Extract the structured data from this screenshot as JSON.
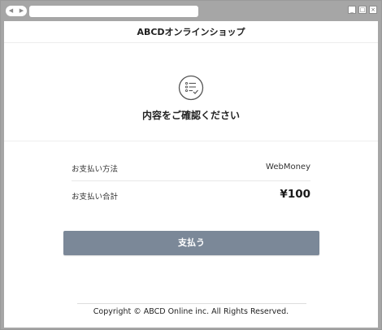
{
  "browser": {
    "nav_icons": [
      "back-icon",
      "forward-icon"
    ],
    "window_controls": [
      "minimize-icon",
      "maximize-icon",
      "close-icon"
    ]
  },
  "header": {
    "shop_name": "ABCDオンラインショップ"
  },
  "confirm": {
    "icon": "checklist-icon",
    "title": "内容をご確認ください"
  },
  "details": {
    "payment_method_label": "お支払い方法",
    "payment_method_value": "WebMoney",
    "total_label": "お支払い合計",
    "total_value": "¥100"
  },
  "actions": {
    "pay_label": "支払う"
  },
  "footer": {
    "copyright": "Copyright © ABCD Online inc. All Rights Reserved."
  },
  "colors": {
    "button": "#7b8898",
    "chrome": "#a6a6a6",
    "text": "#222222"
  }
}
